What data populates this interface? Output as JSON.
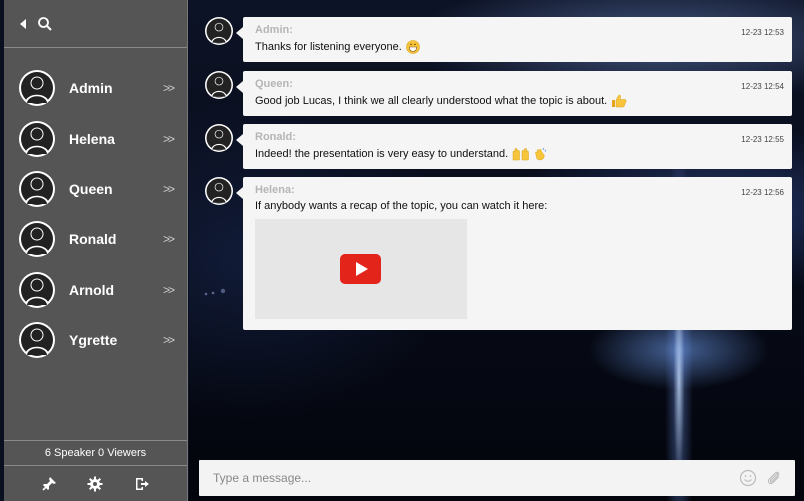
{
  "sidebar": {
    "users": [
      {
        "name": "Admin"
      },
      {
        "name": "Helena"
      },
      {
        "name": "Queen"
      },
      {
        "name": "Ronald"
      },
      {
        "name": "Arnold"
      },
      {
        "name": "Ygrette"
      }
    ],
    "chevron": ">>",
    "status": "6 Speaker 0 Viewers",
    "bottom_icons": [
      "pin-icon",
      "gear-icon",
      "logout-icon"
    ],
    "top_icons": [
      "back-arrow-icon",
      "search-icon"
    ]
  },
  "messages": [
    {
      "sender": "Admin:",
      "time": "12-23 12:53",
      "text": "Thanks for listening everyone.",
      "emoji": [
        "grinning-face-emoji"
      ]
    },
    {
      "sender": "Queen:",
      "time": "12-23 12:54",
      "text": "Good job Lucas, I think we all clearly understood what the topic is about.",
      "emoji": [
        "thumbs-up-emoji"
      ]
    },
    {
      "sender": "Ronald:",
      "time": "12-23 12:55",
      "text": "Indeed! the presentation is very easy to understand.",
      "emoji": [
        "raising-hands-emoji",
        "clapping-hands-emoji"
      ]
    },
    {
      "sender": "Helena:",
      "time": "12-23 12:56",
      "text": "If anybody wants a recap of the topic, you can watch it here:",
      "video": "video-thumbnail",
      "emoji": []
    }
  ],
  "compose": {
    "placeholder": "Type a message...",
    "icons": [
      "smiley-icon",
      "paperclip-icon"
    ]
  },
  "colors": {
    "sidebar_bg": "#555555",
    "bubble_bg": "#f5f5f5",
    "sender_text": "#b5b5b5",
    "play_button": "#e3241b",
    "emoji_yellow": "#f7c53b"
  }
}
